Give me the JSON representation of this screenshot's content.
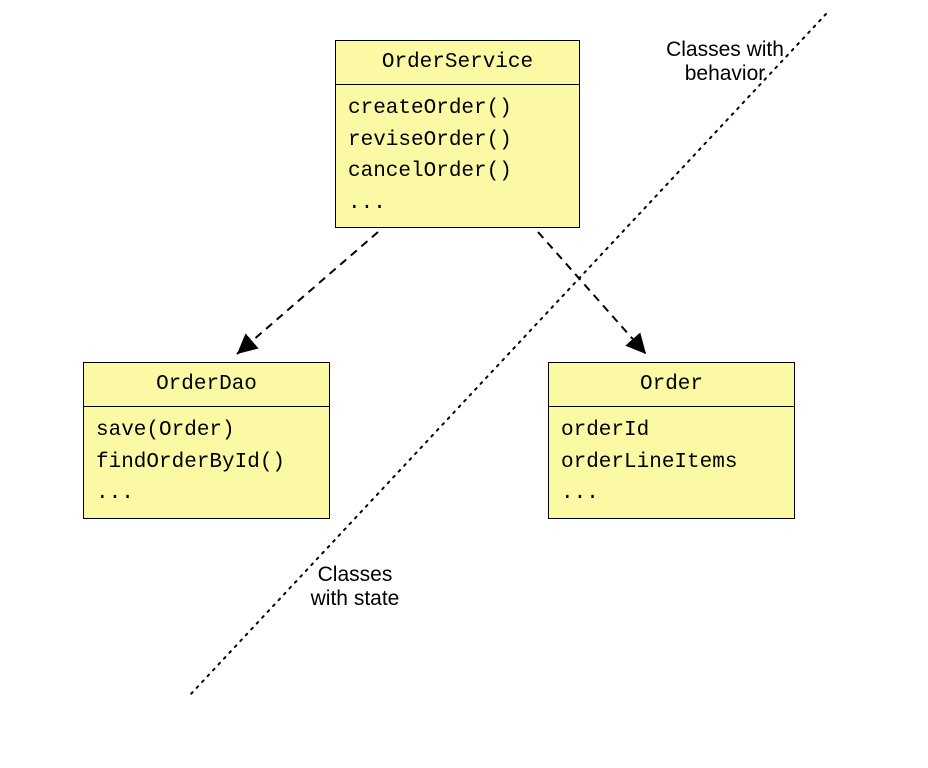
{
  "labels": {
    "behavior_line1": "Classes with",
    "behavior_line2": "behavior",
    "state_line1": "Classes",
    "state_line2": "with state"
  },
  "classes": {
    "orderService": {
      "name": "OrderService",
      "members": [
        "createOrder()",
        "reviseOrder()",
        "cancelOrder()",
        "..."
      ]
    },
    "orderDao": {
      "name": "OrderDao",
      "members": [
        "save(Order)",
        "findOrderById()",
        "..."
      ]
    },
    "order": {
      "name": "Order",
      "members": [
        "orderId",
        "orderLineItems",
        "..."
      ]
    }
  }
}
